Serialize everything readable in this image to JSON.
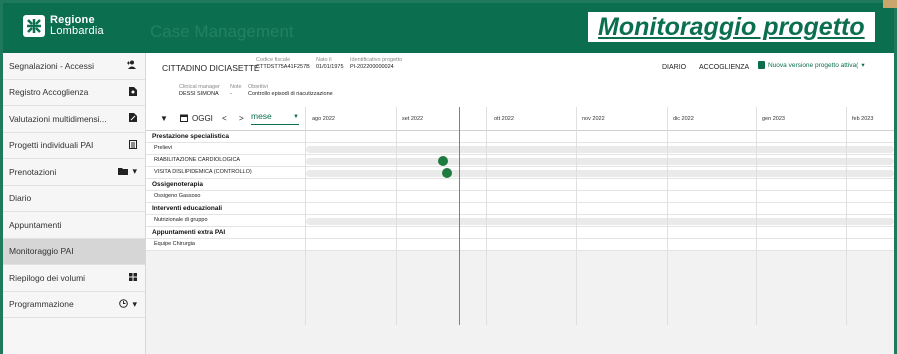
{
  "brand": {
    "line1": "Regione",
    "line2": "Lombardia"
  },
  "app_title": "Case Management",
  "slide_title": "Monitoraggio progetto",
  "sidebar": {
    "items": [
      {
        "label": "Segnalazioni - Accessi",
        "icon": "person-add-icon"
      },
      {
        "label": "Registro Accoglienza",
        "icon": "document-search-icon"
      },
      {
        "label": "Valutazioni multidimensi...",
        "icon": "document-edit-icon"
      },
      {
        "label": "Progetti individuali PAI",
        "icon": "list-icon"
      },
      {
        "label": "Prenotazioni",
        "icon": "folder-icon"
      },
      {
        "label": "Diario"
      },
      {
        "label": "Appuntamenti"
      },
      {
        "label": "Monitoraggio PAI",
        "active": true
      },
      {
        "label": "Riepilogo dei volumi",
        "icon": "grid-icon"
      },
      {
        "label": "Programmazione",
        "icon": "clock-icon"
      }
    ]
  },
  "patient": {
    "name": "CITTADINO DICIASETTE",
    "codice_fiscale_label": "Codice fiscale",
    "codice_fiscale": "CTTDST75A41F257B",
    "nato_label": "Nato il",
    "nato": "01/01/1975",
    "id_label": "Identificativo progetto",
    "id": "PI-202200000024",
    "clinical_label": "Clinical manager",
    "clinical": "DESSI SIMONA",
    "note_label": "Note",
    "note": "-",
    "obiettivi_label": "Obiettivi",
    "obiettivi": "Controllo episodi di riacutizzazione"
  },
  "header_actions": {
    "diario": "DIARIO",
    "accoglienza": "ACCOGLIENZA",
    "nuova_versione": "Nuova versione progetto attiva("
  },
  "toolbar": {
    "oggi": "OGGI",
    "scale": "mese",
    "prev": "<",
    "next": ">"
  },
  "timeline": {
    "months": [
      "ago 2022",
      "set 2022",
      "ott 2022",
      "nov 2022",
      "dic 2022",
      "gen 2023",
      "feb 2023"
    ]
  },
  "rows": [
    {
      "label": "Prestazione specialistica",
      "group": true
    },
    {
      "label": "Prelievi"
    },
    {
      "label": "RIABILITAZIONE CARDIOLOGICA"
    },
    {
      "label": "VISITA DISLIPIDEMICA (CONTROLLO)"
    },
    {
      "label": "Ossigenoterapia",
      "group": true
    },
    {
      "label": "Ossigeno Gassoso"
    },
    {
      "label": "Interventi educazionali",
      "group": true
    },
    {
      "label": "Nutrizionale di gruppo"
    },
    {
      "label": "Appuntamenti extra PAI",
      "group": true
    },
    {
      "label": "Equipe Chirurgia"
    }
  ],
  "colors": {
    "brand_green": "#0b6e4f",
    "event_dot": "#1e7a3e",
    "today_line": "#e0584f"
  }
}
